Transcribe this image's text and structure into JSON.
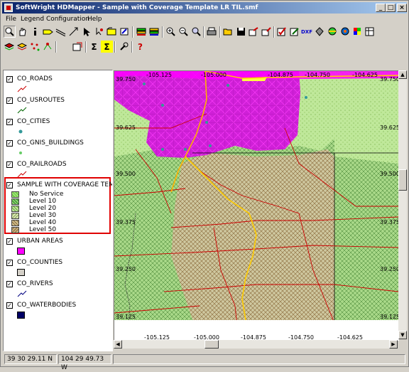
{
  "window": {
    "title": "SoftWright HDMapper - Sample with Coverage Template LR TIL.smf",
    "minimize": "_",
    "maximize": "□",
    "close": "×"
  },
  "menu": [
    "File",
    "Legend",
    "Configuration",
    "Help"
  ],
  "toolbar1_icons": [
    "zoom-icon",
    "pan-hand-icon",
    "info-icon",
    "label-icon",
    "measure-icon",
    "line-tool-icon",
    "pointer-icon",
    "point-tool-icon",
    "layer-icon",
    "edit-layer-icon",
    "layers-icon",
    "layers-alt-icon",
    "zoom-in-icon",
    "zoom-out-icon",
    "zoom-extent-icon",
    "print-icon",
    "open-icon",
    "save-icon",
    "export-icon",
    "import-icon",
    "check-icon",
    "edit-icon",
    "dxf-icon",
    "coverage-icon",
    "globe-icon",
    "contour-icon",
    "grid-icon",
    "table-icon"
  ],
  "toolbar1_dxf": "DXF",
  "toolbar2_icons": [
    "layer-stack-icon",
    "layer-stack-alt-icon",
    "scatter-points-icon",
    "link-points-icon",
    "reference-icon",
    "sum-icon",
    "sum-select-icon",
    "tool-icon",
    "help-icon"
  ],
  "toolbar2_text": {
    "sum": "Σ",
    "sum_select": "Σ",
    "help": "?"
  },
  "legend": {
    "layers": [
      {
        "name": "CO_ROADS",
        "checked": "✓",
        "symbol": "road-line-icon",
        "color": "#cc0000"
      },
      {
        "name": "CO_USROUTES",
        "checked": "✓",
        "symbol": "route-line-icon",
        "color": "#006600"
      },
      {
        "name": "CO_CITIES",
        "checked": "✓",
        "symbol": "city-point-icon",
        "color": "#339999"
      },
      {
        "name": "CO_GNIS_BUILDINGS",
        "checked": "✓",
        "symbol": "building-point-icon",
        "color": "#66cc66"
      },
      {
        "name": "CO_RAILROADS",
        "checked": "✓",
        "symbol": "railroad-line-icon",
        "color": "#cc0000"
      },
      {
        "name": "SAMPLE WITH COVERAGE TEMPLATE",
        "checked": "✓",
        "symbol": "coverage-icon",
        "color": "#cc0000"
      },
      {
        "name": "URBAN AREAS",
        "checked": "✓",
        "symbol": "urban-fill-icon",
        "color": "#ff00ff"
      },
      {
        "name": "CO_COUNTIES",
        "checked": "✓",
        "symbol": "county-fill-icon",
        "color": "#d4d0c8"
      },
      {
        "name": "CO_RIVERS",
        "checked": "✓",
        "symbol": "river-line-icon",
        "color": "#000080"
      },
      {
        "name": "CO_WATERBODIES",
        "checked": "✓",
        "symbol": "waterbody-fill-icon",
        "color": "#000066"
      }
    ],
    "coverage_levels": [
      {
        "label": "No Service",
        "color": "#9be870"
      },
      {
        "label": "Level 10",
        "color": "#2a8a2a"
      },
      {
        "label": "Level 20",
        "color": "#9bcc60"
      },
      {
        "label": "Level 30",
        "color": "#b4d88a"
      },
      {
        "label": "Level 40",
        "color": "#8a6a3a"
      },
      {
        "label": "Level 50",
        "color": "#b08a50"
      }
    ]
  },
  "map": {
    "top_ticks": [
      "-105.125",
      "-105.000",
      "-104.875",
      "-104.750",
      "-104.625"
    ],
    "bottom_ticks": [
      "-105.125",
      "-105.000",
      "-104.875",
      "-104.750",
      "-104.625"
    ],
    "right_ticks": [
      "39.750",
      "39.625",
      "39.500",
      "39.375",
      "39.250",
      "39.125"
    ],
    "left_ticks": [
      "39.750",
      "39.625",
      "39.500",
      "39.375",
      "39.250",
      "39.125"
    ],
    "colors": {
      "urban": "#ff00ff",
      "roads": "#cc0000",
      "routes": "#ffcc00",
      "counties": "#000000",
      "service_green": "#bfe89a",
      "coverage_brown": "#c4b890"
    }
  },
  "status": {
    "latitude": "39 30 29.11 N",
    "longitude": "104 29 49.73 W"
  }
}
